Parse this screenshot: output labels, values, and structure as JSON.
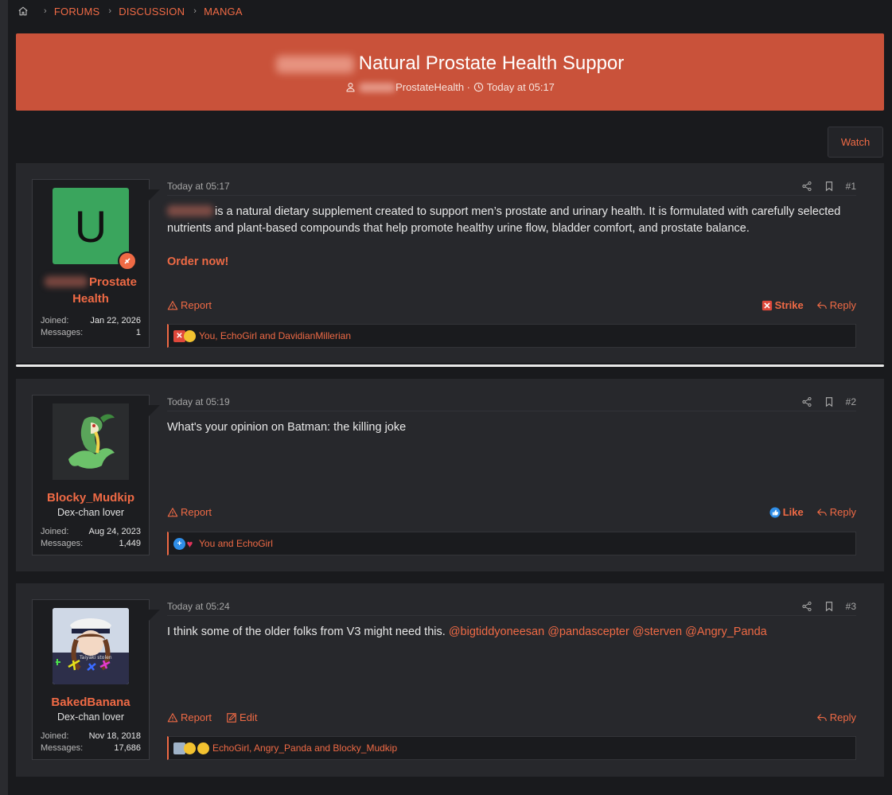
{
  "breadcrumb": {
    "items": [
      "FORUMS",
      "DISCUSSION",
      "MANGA"
    ]
  },
  "thread": {
    "title": "Natural Prostate Health Suppor",
    "author": "ProstateHealth",
    "time": "Today at 05:17"
  },
  "watch_label": "Watch",
  "posts": [
    {
      "time": "Today at 05:17",
      "number": "#1",
      "avatar_letter": "U",
      "avatar_color": "#3aa55d",
      "username_line1": "Prostate",
      "username_line2": "Health",
      "joined_label": "Joined:",
      "joined": "Jan 22, 2026",
      "messages_label": "Messages:",
      "messages": "1",
      "text": "is a natural dietary supplement created to support men’s prostate and urinary health. It is formulated with carefully selected nutrients and plant-based compounds that help promote healthy urine flow, bladder comfort, and prostate balance.",
      "order": "Order now!",
      "report": "Report",
      "strike": "Strike",
      "reply": "Reply",
      "reactions": "You, EchoGirl and DavidianMillerian"
    },
    {
      "time": "Today at 05:19",
      "number": "#2",
      "username": "Blocky_Mudkip",
      "user_title": "Dex-chan lover",
      "joined_label": "Joined:",
      "joined": "Aug 24, 2023",
      "messages_label": "Messages:",
      "messages": "1,449",
      "text": "What's your opinion on Batman: the killing joke",
      "report": "Report",
      "like": "Like",
      "reply": "Reply",
      "reactions": "You and EchoGirl"
    },
    {
      "time": "Today at 05:24",
      "number": "#3",
      "username": "BakedBanana",
      "user_title": "Dex-chan lover",
      "joined_label": "Joined:",
      "joined": "Nov 18, 2018",
      "messages_label": "Messages:",
      "messages": "17,686",
      "avatar_caption": "Taiyaki stolen",
      "text": "I think some of the older folks from V3 might need this.",
      "mentions": [
        "@bigtiddyoneesan",
        "@pandascepter",
        "@sterven",
        "@Angry_Panda"
      ],
      "report": "Report",
      "edit": "Edit",
      "reply": "Reply",
      "reactions": "EchoGirl, Angry_Panda and Blocky_Mudkip"
    }
  ],
  "icons": [
    "home-icon",
    "user-icon",
    "clock-icon",
    "share-icon",
    "bookmark-icon",
    "warning-icon",
    "reply-icon",
    "strike-icon",
    "like-icon",
    "edit-icon"
  ]
}
